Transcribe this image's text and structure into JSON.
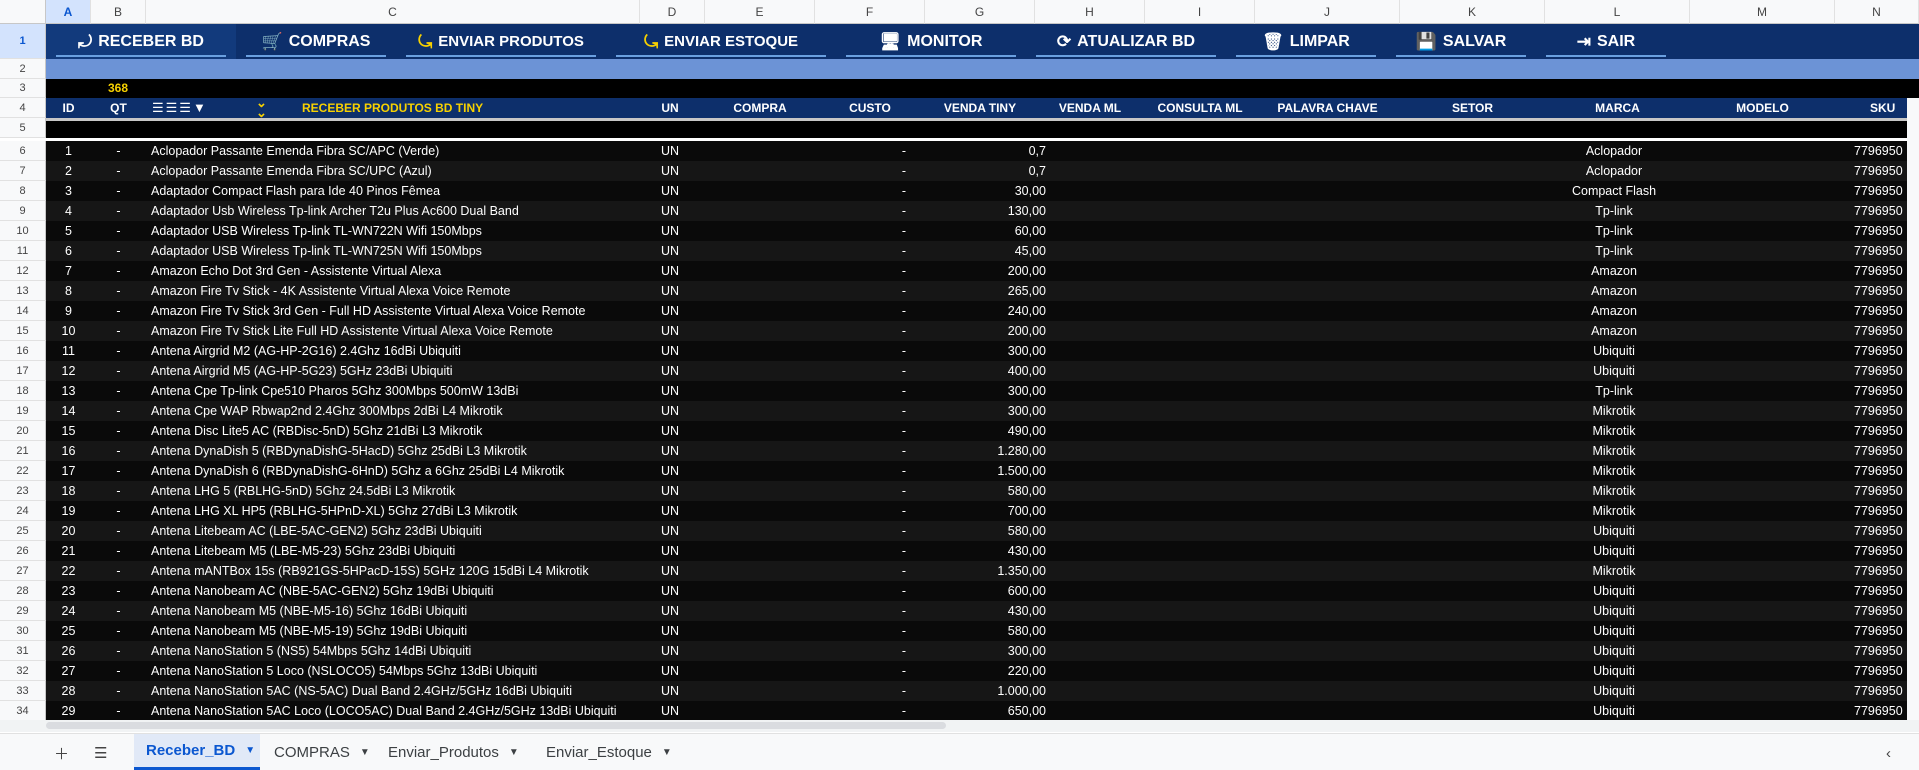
{
  "columns": [
    "A",
    "B",
    "C",
    "D",
    "E",
    "F",
    "G",
    "H",
    "I",
    "J",
    "K",
    "L",
    "M",
    "N"
  ],
  "toolbar": [
    {
      "label": "RECEBER BD",
      "icon": "download-db-icon",
      "active": true
    },
    {
      "label": "COMPRAS",
      "icon": "cart-icon",
      "active": false
    },
    {
      "label": "ENVIAR PRODUTOS",
      "icon": "upload-db-icon",
      "active": false
    },
    {
      "label": "ENVIAR ESTOQUE",
      "icon": "upload-db-icon",
      "active": false
    },
    {
      "label": "MONITOR",
      "icon": "monitor-icon",
      "active": false
    },
    {
      "label": "ATUALIZAR BD",
      "icon": "refresh-icon",
      "active": false
    },
    {
      "label": "LIMPAR",
      "icon": "trash-icon",
      "active": false
    },
    {
      "label": "SALVAR",
      "icon": "save-icon",
      "active": false
    },
    {
      "label": "SAIR",
      "icon": "exit-icon",
      "active": false
    }
  ],
  "row_count": "368",
  "header": {
    "id": "ID",
    "qt": "QT",
    "section_title": "RECEBER PRODUTOS BD TINY",
    "un": "UN",
    "compra": "COMPRA",
    "custo": "CUSTO",
    "venda_tiny": "VENDA TINY",
    "venda_ml": "VENDA ML",
    "consulta_ml": "CONSULTA ML",
    "palavra_chave": "PALAVRA CHAVE",
    "setor": "SETOR",
    "marca": "MARCA",
    "modelo": "MODELO",
    "sku": "SKU"
  },
  "rows": [
    {
      "row": "6",
      "id": "1",
      "qt": "-",
      "desc": "Aclopador Passante Emenda Fibra SC/APC (Verde)",
      "un": "UN",
      "custo": "-",
      "venda": "0,7",
      "marca": "Aclopador",
      "sku": "7796950"
    },
    {
      "row": "7",
      "id": "2",
      "qt": "-",
      "desc": "Aclopador Passante Emenda Fibra SC/UPC (Azul)",
      "un": "UN",
      "custo": "-",
      "venda": "0,7",
      "marca": "Aclopador",
      "sku": "7796950"
    },
    {
      "row": "8",
      "id": "3",
      "qt": "-",
      "desc": "Adaptador Compact Flash para Ide 40 Pinos Fêmea",
      "un": "UN",
      "custo": "-",
      "venda": "30,00",
      "marca": "Compact Flash",
      "sku": "7796950"
    },
    {
      "row": "9",
      "id": "4",
      "qt": "-",
      "desc": "Adaptador Usb Wireless Tp-link Archer T2u Plus Ac600 Dual Band",
      "un": "UN",
      "custo": "-",
      "venda": "130,00",
      "marca": "Tp-link",
      "sku": "7796950"
    },
    {
      "row": "10",
      "id": "5",
      "qt": "-",
      "desc": "Adaptador USB Wireless Tp-link TL-WN722N Wifi 150Mbps",
      "un": "UN",
      "custo": "-",
      "venda": "60,00",
      "marca": "Tp-link",
      "sku": "7796950"
    },
    {
      "row": "11",
      "id": "6",
      "qt": "-",
      "desc": "Adaptador USB Wireless Tp-link TL-WN725N Wifi 150Mbps",
      "un": "UN",
      "custo": "-",
      "venda": "45,00",
      "marca": "Tp-link",
      "sku": "7796950"
    },
    {
      "row": "12",
      "id": "7",
      "qt": "-",
      "desc": "Amazon Echo Dot 3rd Gen - Assistente Virtual Alexa",
      "un": "UN",
      "custo": "-",
      "venda": "200,00",
      "marca": "Amazon",
      "sku": "7796950"
    },
    {
      "row": "13",
      "id": "8",
      "qt": "-",
      "desc": "Amazon Fire Tv Stick - 4K Assistente Virtual Alexa Voice Remote",
      "un": "UN",
      "custo": "-",
      "venda": "265,00",
      "marca": "Amazon",
      "sku": "7796950"
    },
    {
      "row": "14",
      "id": "9",
      "qt": "-",
      "desc": "Amazon Fire Tv Stick 3rd Gen - Full HD Assistente Virtual Alexa Voice Remote",
      "un": "UN",
      "custo": "-",
      "venda": "240,00",
      "marca": "Amazon",
      "sku": "7796950"
    },
    {
      "row": "15",
      "id": "10",
      "qt": "-",
      "desc": "Amazon Fire Tv Stick Lite Full HD Assistente Virtual Alexa Voice Remote",
      "un": "UN",
      "custo": "-",
      "venda": "200,00",
      "marca": "Amazon",
      "sku": "7796950"
    },
    {
      "row": "16",
      "id": "11",
      "qt": "-",
      "desc": "Antena Airgrid M2 (AG-HP-2G16) 2.4Ghz 16dBi Ubiquiti",
      "un": "UN",
      "custo": "-",
      "venda": "300,00",
      "marca": "Ubiquiti",
      "sku": "7796950"
    },
    {
      "row": "17",
      "id": "12",
      "qt": "-",
      "desc": "Antena Airgrid M5 (AG-HP-5G23) 5GHz 23dBi Ubiquiti",
      "un": "UN",
      "custo": "-",
      "venda": "400,00",
      "marca": "Ubiquiti",
      "sku": "7796950"
    },
    {
      "row": "18",
      "id": "13",
      "qt": "-",
      "desc": "Antena Cpe Tp-link Cpe510 Pharos 5Ghz 300Mbps 500mW 13dBi",
      "un": "UN",
      "custo": "-",
      "venda": "300,00",
      "marca": "Tp-link",
      "sku": "7796950"
    },
    {
      "row": "19",
      "id": "14",
      "qt": "-",
      "desc": "Antena Cpe WAP Rbwap2nd 2.4Ghz 300Mbps 2dBi L4 Mikrotik",
      "un": "UN",
      "custo": "-",
      "venda": "300,00",
      "marca": "Mikrotik",
      "sku": "7796950"
    },
    {
      "row": "20",
      "id": "15",
      "qt": "-",
      "desc": "Antena Disc Lite5 AC (RBDisc-5nD) 5Ghz 21dBi L3 Mikrotik",
      "un": "UN",
      "custo": "-",
      "venda": "490,00",
      "marca": "Mikrotik",
      "sku": "7796950"
    },
    {
      "row": "21",
      "id": "16",
      "qt": "-",
      "desc": "Antena DynaDish 5 (RBDynaDishG-5HacD) 5Ghz 25dBi L3 Mikrotik",
      "un": "UN",
      "custo": "-",
      "venda": "1.280,00",
      "marca": "Mikrotik",
      "sku": "7796950"
    },
    {
      "row": "22",
      "id": "17",
      "qt": "-",
      "desc": "Antena DynaDish 6 (RBDynaDishG-6HnD) 5Ghz a 6Ghz 25dBi L4 Mikrotik",
      "un": "UN",
      "custo": "-",
      "venda": "1.500,00",
      "marca": "Mikrotik",
      "sku": "7796950"
    },
    {
      "row": "23",
      "id": "18",
      "qt": "-",
      "desc": "Antena LHG 5 (RBLHG-5nD) 5Ghz 24.5dBi L3 Mikrotik",
      "un": "UN",
      "custo": "-",
      "venda": "580,00",
      "marca": "Mikrotik",
      "sku": "7796950"
    },
    {
      "row": "24",
      "id": "19",
      "qt": "-",
      "desc": "Antena LHG XL HP5 (RBLHG-5HPnD-XL) 5Ghz 27dBi L3 Mikrotik",
      "un": "UN",
      "custo": "-",
      "venda": "700,00",
      "marca": "Mikrotik",
      "sku": "7796950"
    },
    {
      "row": "25",
      "id": "20",
      "qt": "-",
      "desc": "Antena Litebeam AC (LBE-5AC-GEN2) 5Ghz 23dBi Ubiquiti",
      "un": "UN",
      "custo": "-",
      "venda": "580,00",
      "marca": "Ubiquiti",
      "sku": "7796950"
    },
    {
      "row": "26",
      "id": "21",
      "qt": "-",
      "desc": "Antena Litebeam M5 (LBE-M5-23) 5Ghz 23dBi Ubiquiti",
      "un": "UN",
      "custo": "-",
      "venda": "430,00",
      "marca": "Ubiquiti",
      "sku": "7796950"
    },
    {
      "row": "27",
      "id": "22",
      "qt": "-",
      "desc": "Antena mANTBox 15s (RB921GS-5HPacD-15S) 5GHz 120G 15dBi L4 Mikrotik",
      "un": "UN",
      "custo": "-",
      "venda": "1.350,00",
      "marca": "Mikrotik",
      "sku": "7796950"
    },
    {
      "row": "28",
      "id": "23",
      "qt": "-",
      "desc": "Antena Nanobeam AC (NBE-5AC-GEN2) 5Ghz 19dBi Ubiquiti",
      "un": "UN",
      "custo": "-",
      "venda": "600,00",
      "marca": "Ubiquiti",
      "sku": "7796950"
    },
    {
      "row": "29",
      "id": "24",
      "qt": "-",
      "desc": "Antena Nanobeam M5 (NBE-M5-16) 5Ghz 16dBi Ubiquiti",
      "un": "UN",
      "custo": "-",
      "venda": "430,00",
      "marca": "Ubiquiti",
      "sku": "7796950"
    },
    {
      "row": "30",
      "id": "25",
      "qt": "-",
      "desc": "Antena Nanobeam M5 (NBE-M5-19) 5Ghz 19dBi Ubiquiti",
      "un": "UN",
      "custo": "-",
      "venda": "580,00",
      "marca": "Ubiquiti",
      "sku": "7796950"
    },
    {
      "row": "31",
      "id": "26",
      "qt": "-",
      "desc": "Antena NanoStation 5 (NS5) 54Mbps 5Ghz 14dBi Ubiquiti",
      "un": "UN",
      "custo": "-",
      "venda": "300,00",
      "marca": "Ubiquiti",
      "sku": "7796950"
    },
    {
      "row": "32",
      "id": "27",
      "qt": "-",
      "desc": "Antena NanoStation 5 Loco (NSLOCO5) 54Mbps 5Ghz 13dBi Ubiquiti",
      "un": "UN",
      "custo": "-",
      "venda": "220,00",
      "marca": "Ubiquiti",
      "sku": "7796950"
    },
    {
      "row": "33",
      "id": "28",
      "qt": "-",
      "desc": "Antena NanoStation 5AC (NS-5AC) Dual Band 2.4GHz/5GHz 16dBi Ubiquiti",
      "un": "UN",
      "custo": "-",
      "venda": "1.000,00",
      "marca": "Ubiquiti",
      "sku": "7796950"
    },
    {
      "row": "34",
      "id": "29",
      "qt": "-",
      "desc": "Antena NanoStation 5AC Loco (LOCO5AC) Dual Band 2.4GHz/5GHz 13dBi Ubiquiti",
      "un": "UN",
      "custo": "-",
      "venda": "650,00",
      "marca": "Ubiquiti",
      "sku": "7796950"
    }
  ],
  "sheet_tabs": [
    {
      "label": "Receber_BD",
      "active": true
    },
    {
      "label": "COMPRAS",
      "active": false
    },
    {
      "label": "Enviar_Produtos",
      "active": false
    },
    {
      "label": "Enviar_Estoque",
      "active": false
    }
  ],
  "colors": {
    "navy": "#0d2f6b",
    "accent_yellow": "#f7d100",
    "band_blue": "#6c93d6"
  }
}
